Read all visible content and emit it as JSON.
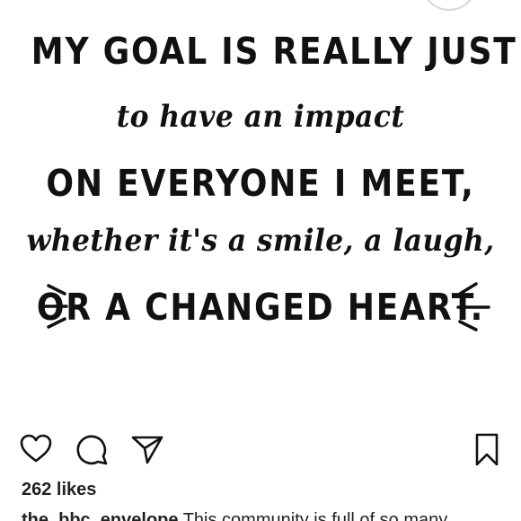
{
  "post": {
    "quote": {
      "top_partial": "",
      "line1": "MY GOAL IS REALLY JUST",
      "line2": "to have an impact",
      "line3": "ON EVERYONE I MEET,",
      "line4": "whether it's a smile, a laugh,",
      "line5": "OR A CHANGED HEART."
    }
  },
  "actions": {
    "like_icon": "heart-outline-icon",
    "comment_icon": "speech-bubble-icon",
    "share_icon": "paper-plane-icon",
    "save_icon": "bookmark-outline-icon"
  },
  "likes": {
    "text": "262 likes"
  },
  "caption": {
    "username": "the_bbc_envelope",
    "text": "This community is full of so many"
  },
  "colors": {
    "text": "#111111",
    "background": "#ffffff"
  }
}
